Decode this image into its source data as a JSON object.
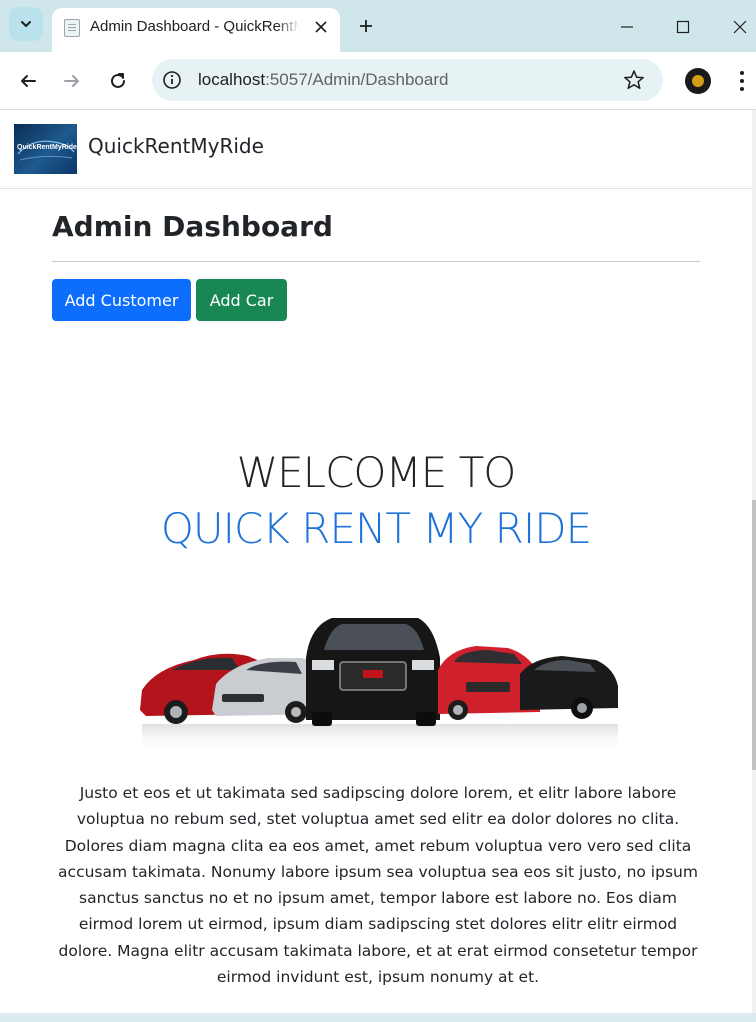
{
  "browser": {
    "tab_title": "Admin Dashboard - QuickRentMyRide",
    "url_host": "localhost",
    "url_path": ":5057/Admin/Dashboard"
  },
  "site": {
    "brand": "QuickRentMyRide",
    "logo_text": "QuickRentMyRide"
  },
  "dashboard": {
    "title": "Admin Dashboard",
    "add_customer_label": "Add Customer",
    "add_car_label": "Add Car"
  },
  "hero": {
    "line1": "WELCOME TO",
    "line2": "QUICK RENT MY RIDE",
    "paragraph": "Justo et eos et ut takimata sed sadipscing dolore lorem, et elitr labore labore voluptua no rebum sed, stet voluptua amet sed elitr ea dolor dolores no clita. Dolores diam magna clita ea eos amet, amet rebum voluptua vero vero sed clita accusam takimata. Nonumy labore ipsum sea voluptua sea eos sit justo, no ipsum sanctus sanctus no et no ipsum amet, tempor labore est labore no. Eos diam eirmod lorem ut eirmod, ipsum diam sadipscing stet dolores elitr elitr eirmod dolore. Magna elitr accusam takimata labore, et at erat eirmod consetetur tempor eirmod invidunt est, ipsum nonumy at et."
  },
  "colors": {
    "primary": "#0d6efd",
    "success": "#198754",
    "accent_blue": "#1e73d8"
  }
}
